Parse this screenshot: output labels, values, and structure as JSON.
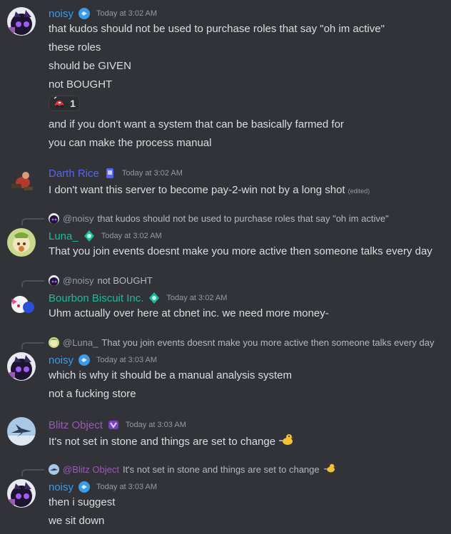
{
  "colors": {
    "background": "#313338",
    "text": "#dbdee1",
    "timestamp": "#949ba4",
    "noisy": "#3b9be8",
    "darth_rice": "#5865f2",
    "luna": "#1abc9c",
    "bourbon": "#1abc9c",
    "blitz": "#9b59b6"
  },
  "messages": [
    {
      "author": "noisy",
      "timestamp": "Today at 3:02 AM",
      "lines": [
        "that kudos should not be used to purchase roles that say \"oh im active\"",
        "these roles",
        "should be GIVEN",
        "not BOUGHT"
      ],
      "reaction": {
        "emoji": "car-emoji",
        "count": "1"
      },
      "lines_after": [
        "and if you don't want a system that can be basically farmed for",
        "you can make the process manual"
      ]
    },
    {
      "author": "Darth Rice",
      "timestamp": "Today at 3:02 AM",
      "lines": [
        "I don't want this server to become pay-2-win not by a long shot"
      ],
      "edited": "(edited)"
    },
    {
      "reply_to": {
        "mention": "@noisy",
        "text": "that kudos should not be used to purchase roles that say \"oh im active\""
      },
      "author": "Luna_",
      "timestamp": "Today at 3:02 AM",
      "lines": [
        "That you join events doesnt make you more active then someone talks every day"
      ]
    },
    {
      "reply_to": {
        "mention": "@noisy",
        "text": "not BOUGHT"
      },
      "author": "Bourbon Biscuit Inc.",
      "timestamp": "Today at 3:02 AM",
      "lines": [
        "Uhm actually over here at cbnet inc. we need more money-"
      ]
    },
    {
      "reply_to": {
        "mention": "@Luna_",
        "text": "That you join events doesnt make you more active then someone talks every day"
      },
      "author": "noisy",
      "timestamp": "Today at 3:03 AM",
      "lines": [
        "which is why it should be a manual analysis system",
        "not a fucking store"
      ]
    },
    {
      "author": "Blitz Object",
      "timestamp": "Today at 3:03 AM",
      "lines": [
        "It's not set in stone and things are set to change"
      ]
    },
    {
      "reply_to": {
        "mention": "@Blitz Object",
        "text": "It's not set in stone and things are set to change"
      },
      "author": "noisy",
      "timestamp": "Today at 3:03 AM",
      "lines": [
        "then i suggest",
        "we sit down"
      ]
    }
  ]
}
